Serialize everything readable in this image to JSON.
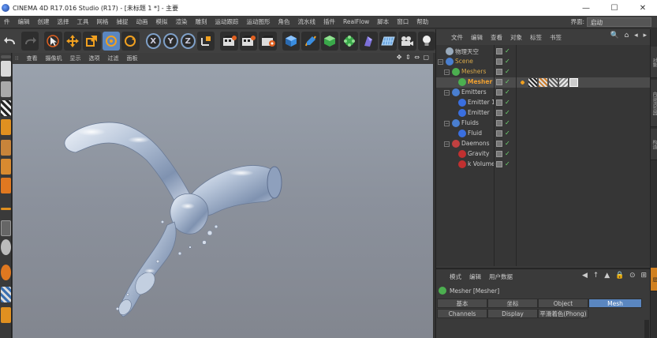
{
  "window": {
    "title": "CINEMA 4D R17.016 Studio (R17) - [未标题 1 *] - 主要",
    "min_glyph": "—",
    "max_glyph": "☐",
    "close_glyph": "✕"
  },
  "menubar": {
    "items": [
      "件",
      "编辑",
      "创建",
      "选择",
      "工具",
      "网格",
      "捕捉",
      "动画",
      "模拟",
      "渲染",
      "雕刻",
      "运动跟踪",
      "运动图形",
      "角色",
      "流水线",
      "插件",
      "RealFlow",
      "脚本",
      "窗口",
      "帮助"
    ],
    "layout_label": "界面:",
    "layout_value": "启动"
  },
  "viewport": {
    "menu": [
      "查看",
      "摄像机",
      "显示",
      "选项",
      "过滤",
      "面板"
    ],
    "nav_icons": "✥ ⇕ ⇔ ▢"
  },
  "object_manager": {
    "menu": [
      "文件",
      "编辑",
      "查看",
      "对象",
      "标签",
      "书签"
    ],
    "tools_glyphs": "🔍 ⌂ ◂ ▸",
    "objects": [
      {
        "name": "物理天空",
        "level": 0,
        "color": "#9ab",
        "highlight": false
      },
      {
        "name": "Scene",
        "level": 0,
        "color": "#4a7fd0",
        "highlight": false,
        "text_color": "#d7a84a"
      },
      {
        "name": "Meshers",
        "level": 1,
        "color": "#4caf50",
        "highlight": false,
        "text_color": "#d7a84a"
      },
      {
        "name": "Mesher",
        "level": 2,
        "color": "#4caf50",
        "highlight": true,
        "text_color": "#f0a030"
      },
      {
        "name": "Emitters",
        "level": 1,
        "color": "#4a7fd0",
        "highlight": false
      },
      {
        "name": "Emitter 1",
        "level": 2,
        "color": "#3a6fe0",
        "highlight": false
      },
      {
        "name": "Emitter",
        "level": 2,
        "color": "#3a6fe0",
        "highlight": false
      },
      {
        "name": "Fluids",
        "level": 1,
        "color": "#4a7fd0",
        "highlight": false
      },
      {
        "name": "Fluid",
        "level": 2,
        "color": "#3a6fe0",
        "highlight": false
      },
      {
        "name": "Daemons",
        "level": 1,
        "color": "#c04040",
        "highlight": false
      },
      {
        "name": "Gravity",
        "level": 2,
        "color": "#c03030",
        "highlight": false
      },
      {
        "name": "k Volume",
        "level": 2,
        "color": "#c03030",
        "highlight": false
      }
    ]
  },
  "attribute_manager": {
    "menu": [
      "模式",
      "编辑",
      "用户数据"
    ],
    "tools_glyphs": "◀ ↑ ▲ 🔒 ⊙ ⊞",
    "title": "Mesher [Mesher]",
    "tabs_row1": [
      "基本",
      "坐标",
      "Object",
      "Mesh"
    ],
    "tabs_row2": [
      "Channels",
      "Display",
      "平滑着色(Phong)"
    ],
    "active_tab": "Mesh"
  },
  "right_strip": {
    "tabs": [
      "对象",
      "内容浏览器",
      "构造",
      "层"
    ]
  },
  "colors": {
    "accent": "#5a86c0",
    "selected_object": "#f0a030",
    "viewport_bg": "#8b919c"
  }
}
